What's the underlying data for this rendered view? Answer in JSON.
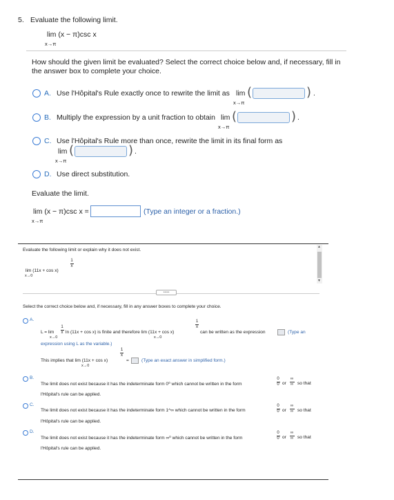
{
  "q5": {
    "number": "5.",
    "prompt": "Evaluate the following limit.",
    "expr_main": "lim (x − π)csc x",
    "expr_sub": "x→π",
    "instruction_line1": "How should the given limit be evaluated? Select the correct choice below and, if necessary, fill in",
    "instruction_line2": "the answer box to complete your choice.",
    "options": [
      {
        "letter": "A.",
        "text": "Use l'Hôpital's Rule exactly once to rewrite the limit as",
        "lim": "lim",
        "sub": "x→π"
      },
      {
        "letter": "B.",
        "text": "Multiply the expression by a unit fraction to obtain",
        "lim": "lim",
        "sub": "x→π"
      },
      {
        "letter": "C.",
        "text": "Use l'Hôpital's Rule more than once, rewrite the limit in its final form as",
        "lim": "lim",
        "sub": "x→π"
      },
      {
        "letter": "D.",
        "text": "Use direct substitution."
      }
    ],
    "evaluate_label": "Evaluate the limit.",
    "final_expr": "lim (x − π)csc x =",
    "final_sub": "x→π",
    "final_hint": "(Type an integer or a fraction.)"
  },
  "q2": {
    "prompt": "Evaluate the following limit or explain why it does not exist.",
    "expr": "lim (11x + cos x)",
    "expr_sub": "x→0",
    "exp_num": "1",
    "exp_den": "x",
    "divider_dots": "•••••",
    "instruction": "Select the correct choice below and, if necessary, fill in any answer boxes to complete your choice.",
    "optA": {
      "letter": "A.",
      "l_eq": "L = lim",
      "l_sub": "x→0",
      "frac_num": "1",
      "frac_den": "x",
      "ln_text": "ln (11x + cos x) is finite and therefore  lim (11x + cos x)",
      "lim_sub": "x→0",
      "exp_num": "1",
      "exp_den": "x",
      "tail": "can be written as the expression",
      "hint": "(Type an",
      "line2": "expression using L as the variable.)",
      "implies": "This implies that  lim (11x + cos x)",
      "implies_sub": "x→0",
      "implies_exp_num": "1",
      "implies_exp_den": "x",
      "eq": "=",
      "implies_hint": "(Type an exact answer in simplified form.)"
    },
    "optB": {
      "letter": "B.",
      "text": "The limit does not exist because it has the indeterminate form 0⁰ which cannot be written in the form",
      "f1n": "0",
      "f1d": "0",
      "or": "or",
      "f2n": "∞",
      "f2d": "∞",
      "tail": "so that",
      "line2": "l'Hôpital's rule can be applied."
    },
    "optC": {
      "letter": "C.",
      "text": "The limit does not exist because it has the indeterminate form 1^∞ which cannot be written in the form",
      "f1n": "0",
      "f1d": "0",
      "or": "or",
      "f2n": "∞",
      "f2d": "∞",
      "tail": "so that",
      "line2": "l'Hôpital's rule can be applied."
    },
    "optD": {
      "letter": "D.",
      "text": "The limit does not exist because it has the indeterminate form ∞⁰ which cannot be written in the form",
      "f1n": "0",
      "f1d": "0",
      "or": "or",
      "f2n": "∞",
      "f2d": "∞",
      "tail": "so that",
      "line2": "l'Hôpital's rule can be applied."
    }
  }
}
